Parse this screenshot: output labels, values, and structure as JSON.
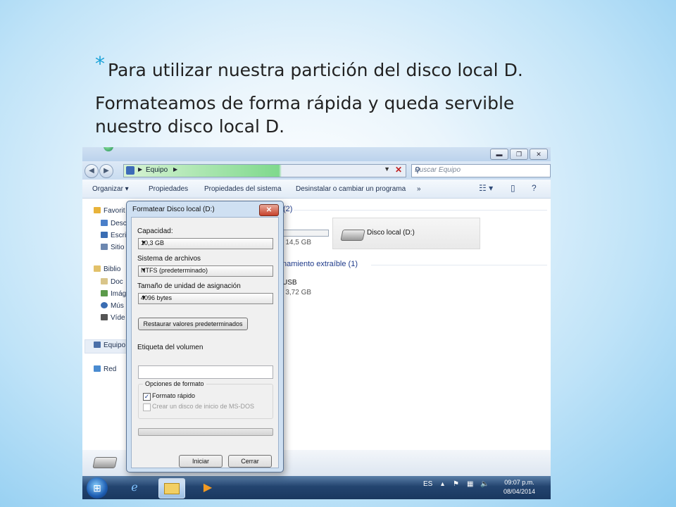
{
  "slide": {
    "bullet": "*",
    "title": "Para utilizar nuestra partición del disco local D.",
    "body": "Formateamos de forma rápida y queda servible nuestro disco local D."
  },
  "explorer": {
    "window_buttons": {
      "minimize": "▬",
      "maximize": "❐",
      "close": "✕"
    },
    "address_path": "Equipo",
    "search_placeholder": "Buscar Equipo",
    "toolbar": {
      "organize": "Organizar ▾",
      "properties": "Propiedades",
      "system_properties": "Propiedades del sistema",
      "uninstall": "Desinstalar o cambiar un programa",
      "more": "»"
    },
    "nav": {
      "favorites": "Favorit",
      "desktop": "Desc",
      "downloads": "Escri",
      "recent": "Sitio",
      "libraries": "Biblio",
      "documents": "Doc",
      "pictures": "Imág",
      "music": "Mús",
      "videos": "Víde",
      "computer": "Equipo",
      "network": "Red"
    },
    "content": {
      "hard_disks_count": "(2)",
      "drive_c_free": "e 14,5 GB",
      "drive_d_label": "Disco local (D:)",
      "removable_header": "namiento extraíble (1)",
      "usb_label": "USB",
      "usb_free": "e 3,72 GB"
    }
  },
  "dialog": {
    "title": "Formatear Disco local (D:)",
    "close": "✕",
    "capacity_label": "Capacidad:",
    "capacity_value": "10,3 GB",
    "filesystem_label": "Sistema de archivos",
    "filesystem_value": "NTFS (predeterminado)",
    "allocation_label": "Tamaño de unidad de asignación",
    "allocation_value": "4096 bytes",
    "restore_button": "Restaurar valores predeterminados",
    "volume_label": "Etiqueta del volumen",
    "volume_value": "",
    "options_title": "Opciones de formato",
    "quick_format": "Formato rápido",
    "quick_format_checked": true,
    "ms_dos": "Crear un disco de inicio de MS-DOS",
    "ms_dos_checked": false,
    "progress": 0,
    "start_button": "Iniciar",
    "cancel_button": "Cerrar"
  },
  "taskbar": {
    "language": "ES",
    "time": "09:07 p.m.",
    "date": "08/04/2014"
  }
}
